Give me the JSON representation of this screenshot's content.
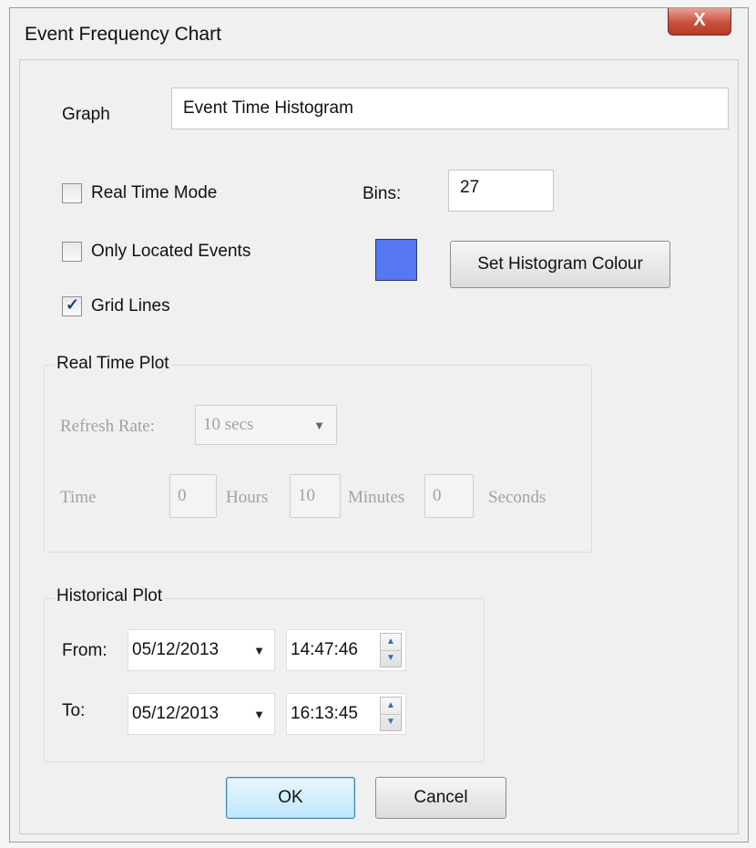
{
  "window": {
    "title": "Event Frequency Chart",
    "close_glyph": "X"
  },
  "graph": {
    "label": "Graph",
    "value": "Event Time Histogram"
  },
  "options": {
    "real_time_mode": {
      "label": "Real Time Mode",
      "checked": false
    },
    "only_located_events": {
      "label": "Only Located Events",
      "checked": false
    },
    "grid_lines": {
      "label": "Grid Lines",
      "checked": true,
      "check_glyph": "✓"
    }
  },
  "bins": {
    "label": "Bins:",
    "value": "27"
  },
  "histogram_colour": {
    "swatch_color": "#5577f0",
    "button_label": "Set Histogram Colour"
  },
  "real_time_plot": {
    "title": "Real Time Plot",
    "refresh_rate_label": "Refresh Rate:",
    "refresh_rate_value": "10 secs",
    "time_label": "Time",
    "hours_value": "0",
    "hours_label": "Hours",
    "minutes_value": "10",
    "minutes_label": "Minutes",
    "seconds_value": "0",
    "seconds_label": "Seconds"
  },
  "historical_plot": {
    "title": "Historical Plot",
    "from_label": "From:",
    "from_date": "05/12/2013",
    "from_time": "14:47:46",
    "to_label": "To:",
    "to_date": "05/12/2013",
    "to_time": "16:13:45"
  },
  "buttons": {
    "ok": "OK",
    "cancel": "Cancel"
  }
}
